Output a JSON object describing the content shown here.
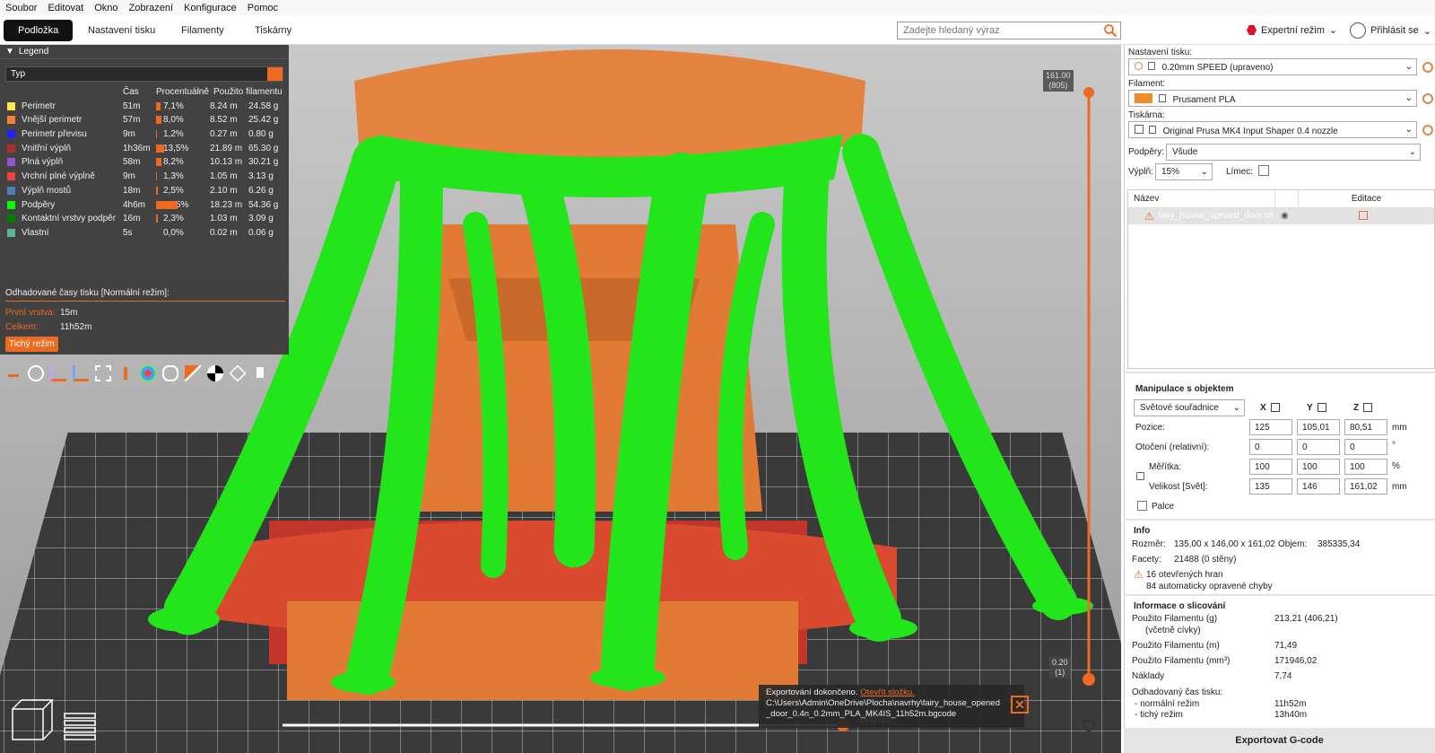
{
  "menu": [
    "Soubor",
    "Editovat",
    "Okno",
    "Zobrazení",
    "Konfigurace",
    "Pomoc"
  ],
  "tabs": [
    "Podložka",
    "Nastavení tisku",
    "Filamenty",
    "Tiskárny"
  ],
  "search": {
    "placeholder": "Zadejte hledaný výraz"
  },
  "mode": "Expertní režim",
  "login": "Přihlásit se",
  "legend": {
    "title": "Legend",
    "select": "Typ",
    "headers": {
      "time": "Čas",
      "percent": "Procentuálně",
      "used": "Použito filamentu"
    },
    "rows": [
      {
        "name": "Perimetr",
        "color": "#FFE64D",
        "time": "51m",
        "percent": "7,1%",
        "pct": 7.1,
        "m": "8.24 m",
        "g": "24.58 g"
      },
      {
        "name": "Vnější perimetr",
        "color": "#FF7D38",
        "time": "57m",
        "percent": "8,0%",
        "pct": 8.0,
        "m": "8.52 m",
        "g": "25.42 g"
      },
      {
        "name": "Perimetr převisu",
        "color": "#1F1FFF",
        "time": "9m",
        "percent": "1,2%",
        "pct": 1.2,
        "m": "0.27 m",
        "g": "0.80 g"
      },
      {
        "name": "Vnitřní výplň",
        "color": "#B03029",
        "time": "1h36m",
        "percent": "13,5%",
        "pct": 13.5,
        "m": "21.89 m",
        "g": "65.30 g"
      },
      {
        "name": "Plná výplň",
        "color": "#9654CC",
        "time": "58m",
        "percent": "8,2%",
        "pct": 8.2,
        "m": "10.13 m",
        "g": "30.21 g"
      },
      {
        "name": "Vrchní plné výplně",
        "color": "#F04040",
        "time": "9m",
        "percent": "1,3%",
        "pct": 1.3,
        "m": "1.05 m",
        "g": "3.13 g"
      },
      {
        "name": "Výplň mostů",
        "color": "#4D80BA",
        "time": "18m",
        "percent": "2,5%",
        "pct": 2.5,
        "m": "2.10 m",
        "g": "6.26 g"
      },
      {
        "name": "Podpěry",
        "color": "#00FF00",
        "time": "4h6m",
        "percent": "34,5%",
        "pct": 34.5,
        "m": "18.23 m",
        "g": "54.36 g"
      },
      {
        "name": "Kontaktní vrstvy podpěr",
        "color": "#008000",
        "time": "16m",
        "percent": "2,3%",
        "pct": 2.3,
        "m": "1.03 m",
        "g": "3.09 g"
      },
      {
        "name": "Vlastní",
        "color": "#5EB59E",
        "time": "5s",
        "percent": "0,0%",
        "pct": 0.0,
        "m": "0.02 m",
        "g": "0.06 g"
      }
    ],
    "estimate_title": "Odhadované časy tisku [Normální režim]:",
    "first_layer_label": "První vrstva:",
    "first_layer": "15m",
    "total_label": "Celkem:",
    "total": "11h52m",
    "quiet_button": "Tichý režim"
  },
  "right": {
    "print_settings_label": "Nastavení tisku:",
    "print_settings": "0.20mm SPEED (upraveno)",
    "filament_label": "Filament:",
    "filament": "Prusament PLA",
    "filament_color": "#F28C28",
    "printer_label": "Tiskárna:",
    "printer": "Original Prusa MK4 Input Shaper 0.4 nozzle",
    "supports_label": "Podpěry:",
    "supports": "Všude",
    "infill_label": "Výplň:",
    "infill": "15%",
    "brim_label": "Límec:",
    "list_name": "Název",
    "list_edit": "Editace",
    "object_name": "fairy_house_opened_door.stl",
    "manip_title": "Manipulace s objektem",
    "coords": "Světové souřadnice",
    "axes": [
      "X",
      "Y",
      "Z"
    ],
    "position_label": "Pozice:",
    "position": [
      "125",
      "105,01",
      "80,51"
    ],
    "rotation_label": "Otočení (relativní):",
    "rotation": [
      "0",
      "0",
      "0"
    ],
    "scale_label": "Měřítka:",
    "scale": [
      "100",
      "100",
      "100"
    ],
    "size_label": "Velikost [Svět]:",
    "size": [
      "135",
      "146",
      "161,02"
    ],
    "unit_mm": "mm",
    "unit_deg": "°",
    "unit_pct": "%",
    "inches_label": "Palce",
    "info_title": "Info",
    "dims_label": "Rozměr:",
    "dims": "135,00 x 146,00 x 161,02",
    "volume_label": "Objem:",
    "volume": "385335,34",
    "facets_label": "Facety:",
    "facets": "21488 (0 stěny)",
    "warn1": "16 otevřených hran",
    "warn2": "84 automaticky opravené chyby",
    "slice_title": "Informace o slicování",
    "fil_g_label": "Použito Filamentu (g)",
    "fil_g_sub": "(včetně cívky)",
    "fil_g": "213,21 (406,21)",
    "fil_m_label": "Použito Filamentu (m)",
    "fil_m": "71,49",
    "fil_mm3_label": "Použito Filamentu (mm³)",
    "fil_mm3": "171946,02",
    "cost_label": "Náklady",
    "cost": "7,74",
    "est_label": "Odhadovaný čas tisku:",
    "normal_label": "- normální režim",
    "normal": "11h52m",
    "quiet_label": "- tichý režim",
    "quiet": "13h40m",
    "export": "Exportovat G-code"
  },
  "notification": {
    "text": "Exportování dokončeno.",
    "link": "Otevřít složku.",
    "path1": "C:\\Users\\Admin\\OneDrive\\Plocha\\navrhy\\fairy_house_opened",
    "path2": "_door_0.4n_0.2mm_PLA_MK4IS_11h52m.bgcode"
  },
  "slider": {
    "top_value": "161.00",
    "top_layer": "(805)",
    "bottom_value": "0.20",
    "bottom_layer": "(1)",
    "horizontal": "1634767"
  }
}
